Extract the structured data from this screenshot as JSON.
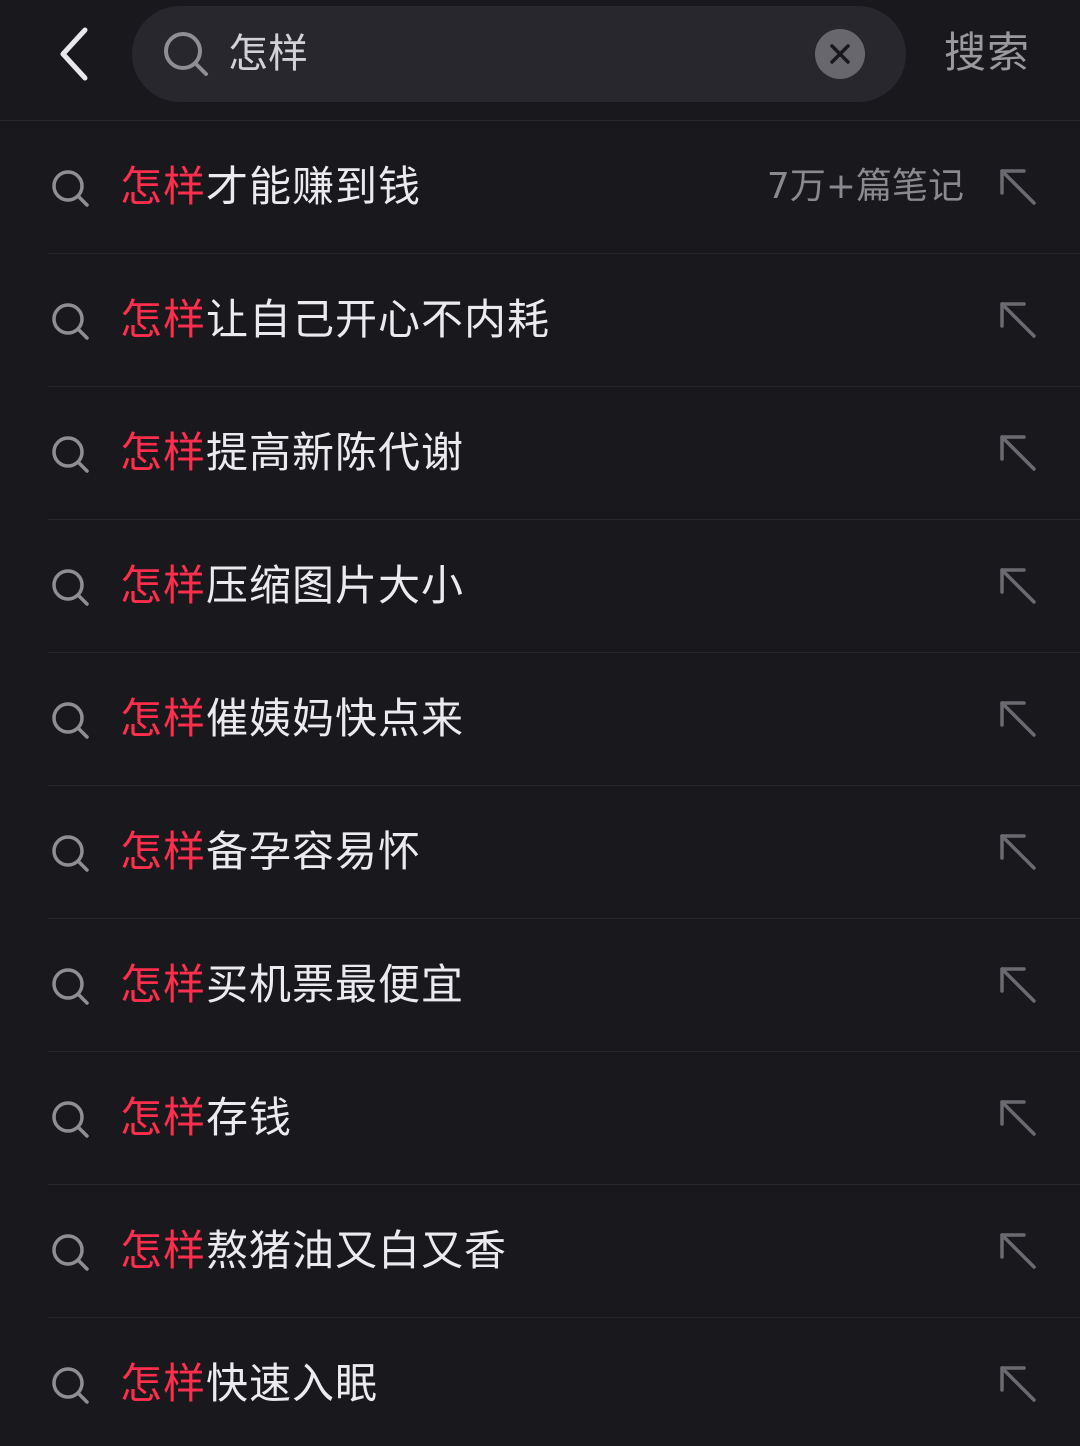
{
  "header": {
    "query": "怎样",
    "submit_label": "搜索"
  },
  "suggestions": [
    {
      "prefix": "怎样",
      "rest": "才能赚到钱",
      "count": "7万+篇笔记"
    },
    {
      "prefix": "怎样",
      "rest": "让自己开心不内耗",
      "count": ""
    },
    {
      "prefix": "怎样",
      "rest": "提高新陈代谢",
      "count": ""
    },
    {
      "prefix": "怎样",
      "rest": "压缩图片大小",
      "count": ""
    },
    {
      "prefix": "怎样",
      "rest": "催姨妈快点来",
      "count": ""
    },
    {
      "prefix": "怎样",
      "rest": "备孕容易怀",
      "count": ""
    },
    {
      "prefix": "怎样",
      "rest": "买机票最便宜",
      "count": ""
    },
    {
      "prefix": "怎样",
      "rest": "存钱",
      "count": ""
    },
    {
      "prefix": "怎样",
      "rest": "熬猪油又白又香",
      "count": ""
    },
    {
      "prefix": "怎样",
      "rest": "快速入眠",
      "count": ""
    }
  ],
  "colors": {
    "background": "#19181d",
    "search_box": "#28272d",
    "highlight": "#ff2e4d",
    "text": "#ebeaef",
    "muted": "#8a898e"
  },
  "icons": {
    "back": "chevron-left-icon",
    "search": "search-icon",
    "clear": "close-icon",
    "fill": "arrow-up-left-icon"
  }
}
